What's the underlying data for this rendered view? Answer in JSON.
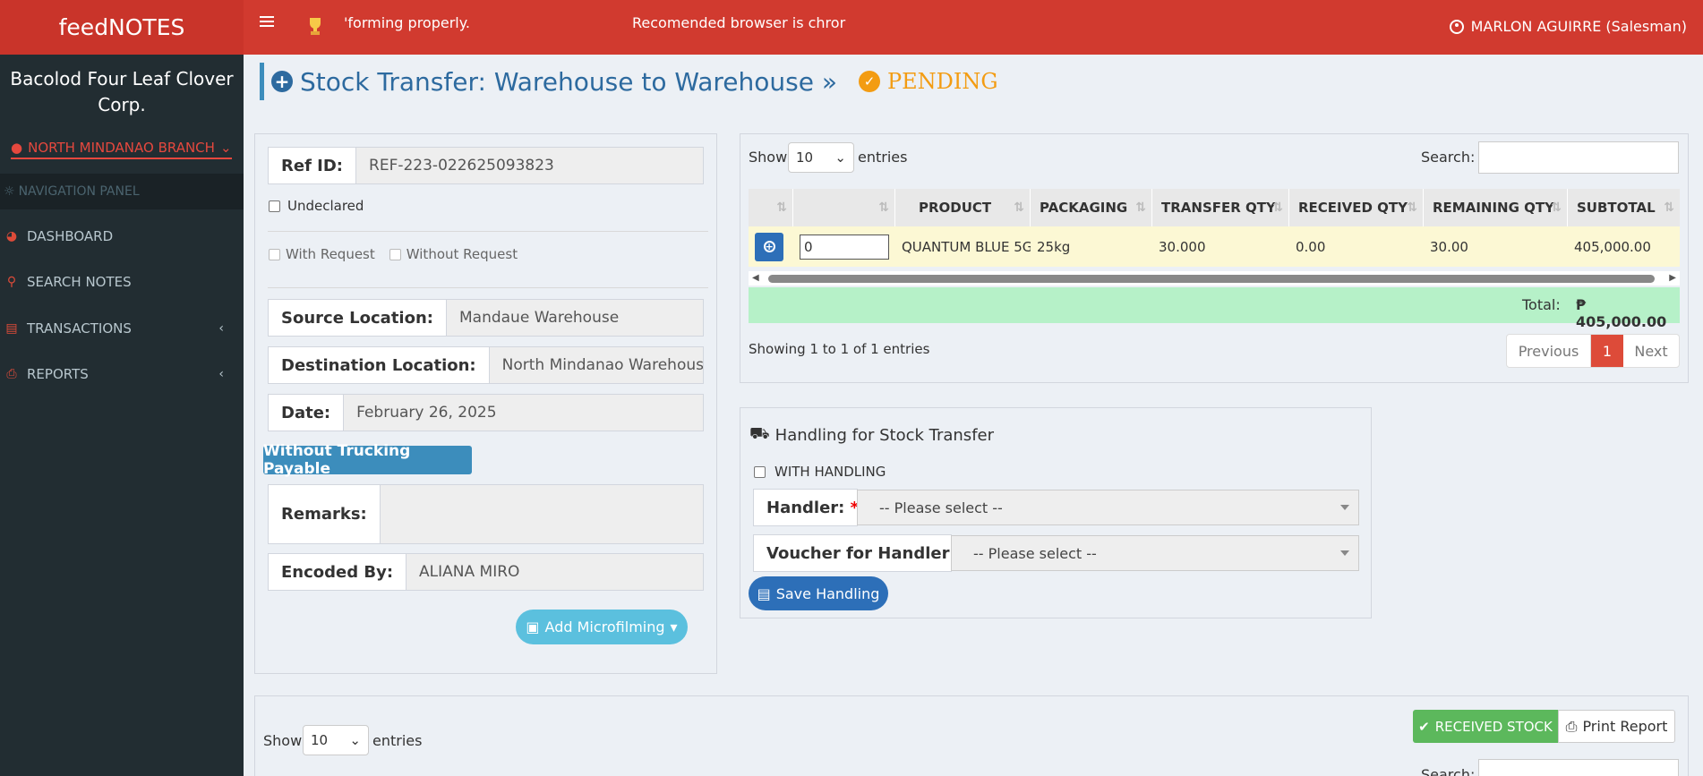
{
  "app": {
    "logo": "feedNOTES",
    "marquee_1": "'forming properly.",
    "marquee_2": "Recomended browser is chror",
    "user": "MARLON AGUIRRE (Salesman)"
  },
  "sidebar": {
    "company": "Bacolod Four Leaf Clover Corp.",
    "branch": "NORTH MINDANAO BRANCH",
    "nav_header": "NAVIGATION PANEL",
    "items": [
      {
        "label": "DASHBOARD",
        "icon": "dashboard-icon"
      },
      {
        "label": "SEARCH NOTES",
        "icon": "search-icon"
      },
      {
        "label": "TRANSACTIONS",
        "icon": "file-icon"
      },
      {
        "label": "REPORTS",
        "icon": "print-icon"
      }
    ]
  },
  "header": {
    "title": "Stock Transfer: Warehouse to Warehouse »",
    "status": "PENDING"
  },
  "form": {
    "ref_label": "Ref ID:",
    "ref_value": "REF-223-022625093823",
    "undeclared": "Undeclared",
    "with_request": "With Request",
    "without_request": "Without Request",
    "source_label": "Source Location:",
    "source_value": "Mandaue Warehouse",
    "dest_label": "Destination Location:",
    "dest_value": "North Mindanao Warehouse",
    "date_label": "Date:",
    "date_value": "February 26, 2025",
    "trucking_button": "Without Trucking Payable",
    "remarks_label": "Remarks:",
    "remarks_value": "",
    "encoded_label": "Encoded By:",
    "encoded_value": "ALIANA MIRO",
    "microfilming_button": "Add Microfilming"
  },
  "table": {
    "show_label": "Show",
    "entries_value": "10",
    "entries_label": "entries",
    "search_label": "Search:",
    "columns": [
      "PRODUCT",
      "PACKAGING",
      "TRANSFER QTY",
      "RECEIVED QTY",
      "REMAINING QTY",
      "SUBTOTAL"
    ],
    "rows": [
      {
        "qty_input": "0",
        "product": "QUANTUM BLUE 5G",
        "packaging": "25kg",
        "transfer_qty": "30.000",
        "received_qty": "0.00",
        "remaining_qty": "30.00",
        "subtotal": "405,000.00"
      }
    ],
    "total_label": "Total:",
    "total_value": "₱ 405,000.00",
    "info": "Showing 1 to 1 of 1 entries",
    "pager": {
      "previous": "Previous",
      "current": "1",
      "next": "Next"
    }
  },
  "handling": {
    "title": "Handling for Stock Transfer",
    "with_handling": "WITH HANDLING",
    "handler_label": "Handler:",
    "handler_placeholder": "-- Please select --",
    "voucher_label": "Voucher for Handler:",
    "voucher_placeholder": "-- Please select --",
    "save_button": "Save Handling"
  },
  "bottom": {
    "show_label": "Show",
    "entries_value": "10",
    "entries_label": "entries",
    "received_button": "RECEIVED STOCK",
    "print_button": "Print Report",
    "search_label": "Search:"
  },
  "colors": {
    "topbar": "#d13a2f",
    "sidebar": "#222d32",
    "accent_blue": "#3c8dbc",
    "pending": "#f39c12",
    "green": "#5cb85c",
    "total_bg": "#b6f1c8"
  }
}
